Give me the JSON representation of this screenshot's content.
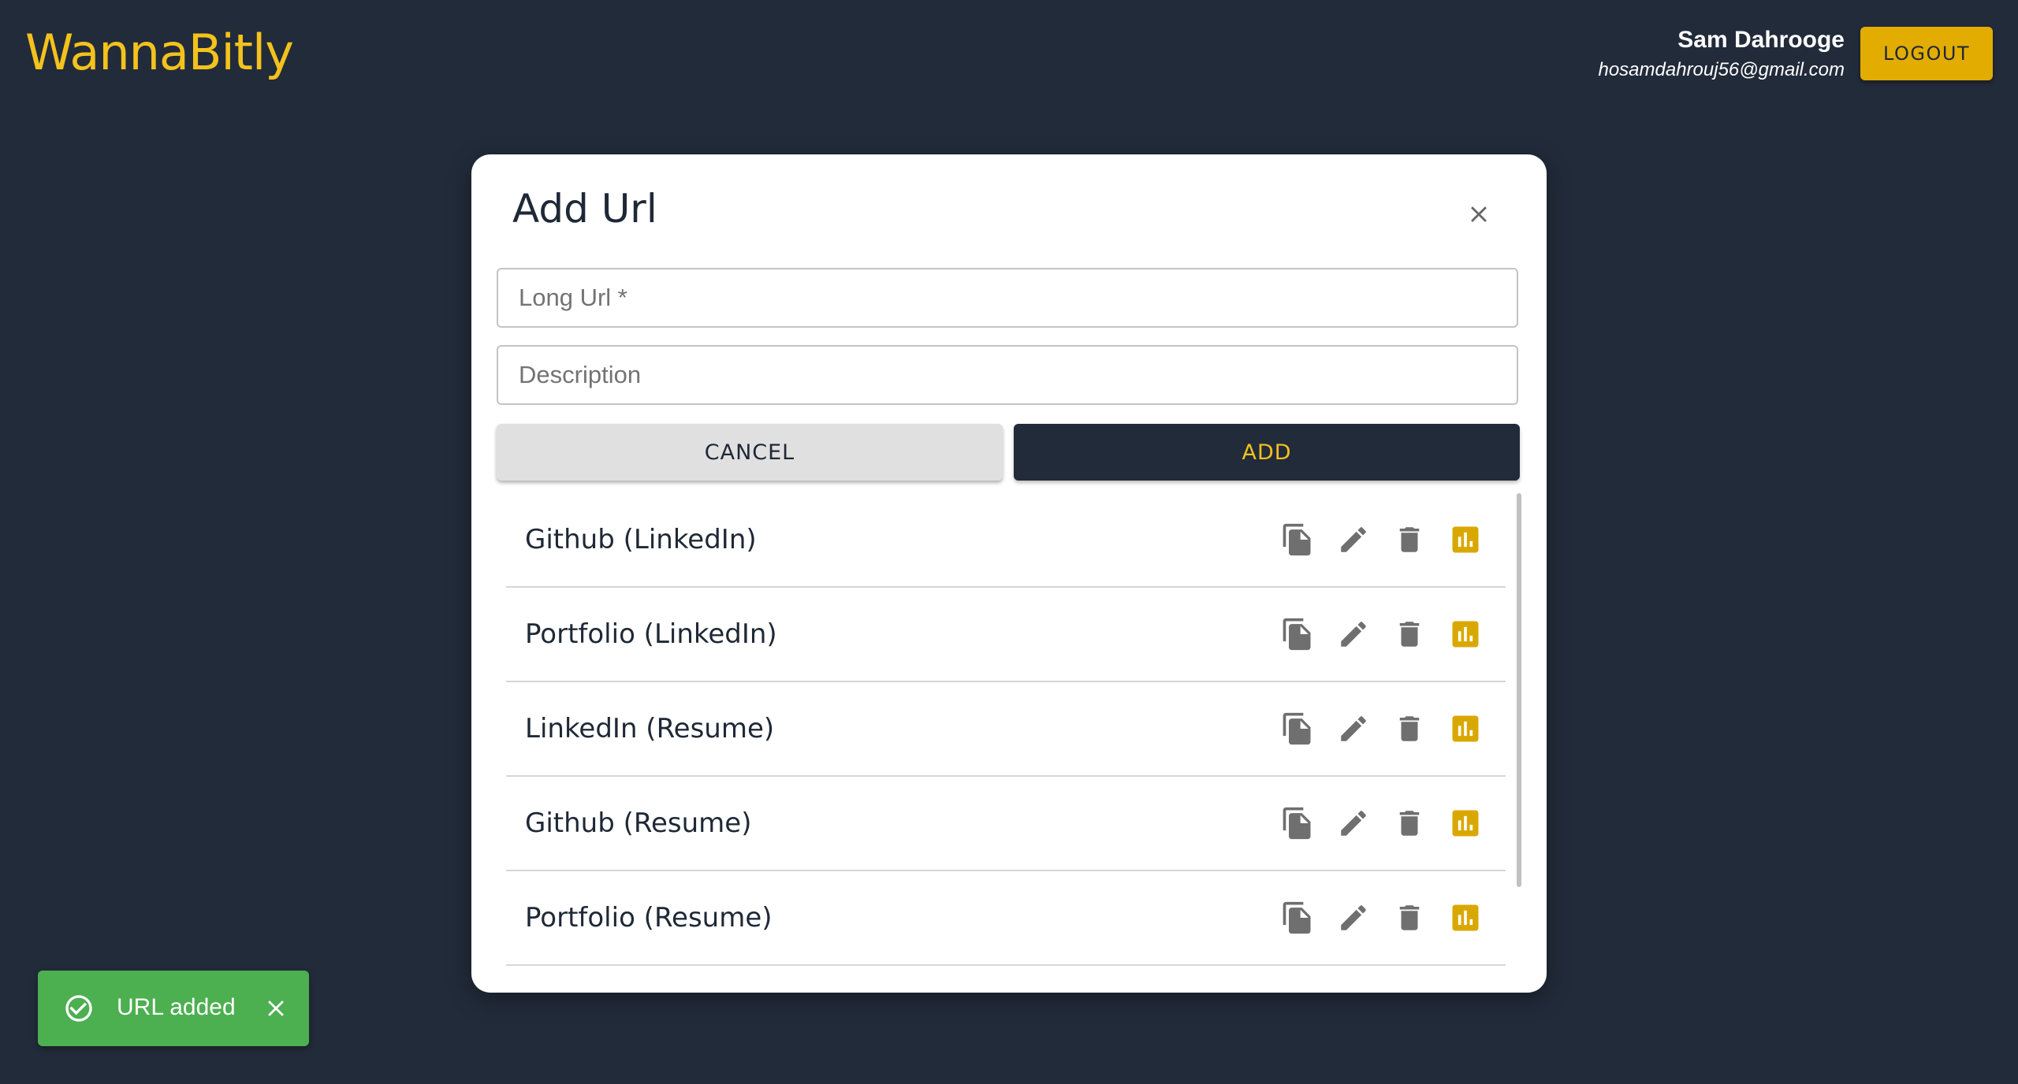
{
  "header": {
    "brand": "WannaBitly",
    "user_name": "Sam Dahrooge",
    "user_email": "hosamdahrouj56@gmail.com",
    "logout_label": "LOGOUT"
  },
  "modal": {
    "title": "Add Url",
    "long_url_placeholder": "Long Url *",
    "long_url_value": "",
    "description_placeholder": "Description",
    "description_value": "",
    "cancel_label": "CANCEL",
    "add_label": "ADD",
    "urls": [
      {
        "label": "Github (LinkedIn)"
      },
      {
        "label": "Portfolio (LinkedIn)"
      },
      {
        "label": "LinkedIn (Resume)"
      },
      {
        "label": "Github (Resume)"
      },
      {
        "label": "Portfolio (Resume)"
      }
    ],
    "action_icons": [
      "copy-icon",
      "edit-icon",
      "delete-icon",
      "stats-icon"
    ]
  },
  "toast": {
    "message": "URL added",
    "icon": "check-circle-icon"
  },
  "colors": {
    "background": "#222b3a",
    "accent": "#f4c21d",
    "logout_bg": "#e2ac00",
    "stats_icon": "#d9a800",
    "toast_bg": "#4caf50"
  }
}
